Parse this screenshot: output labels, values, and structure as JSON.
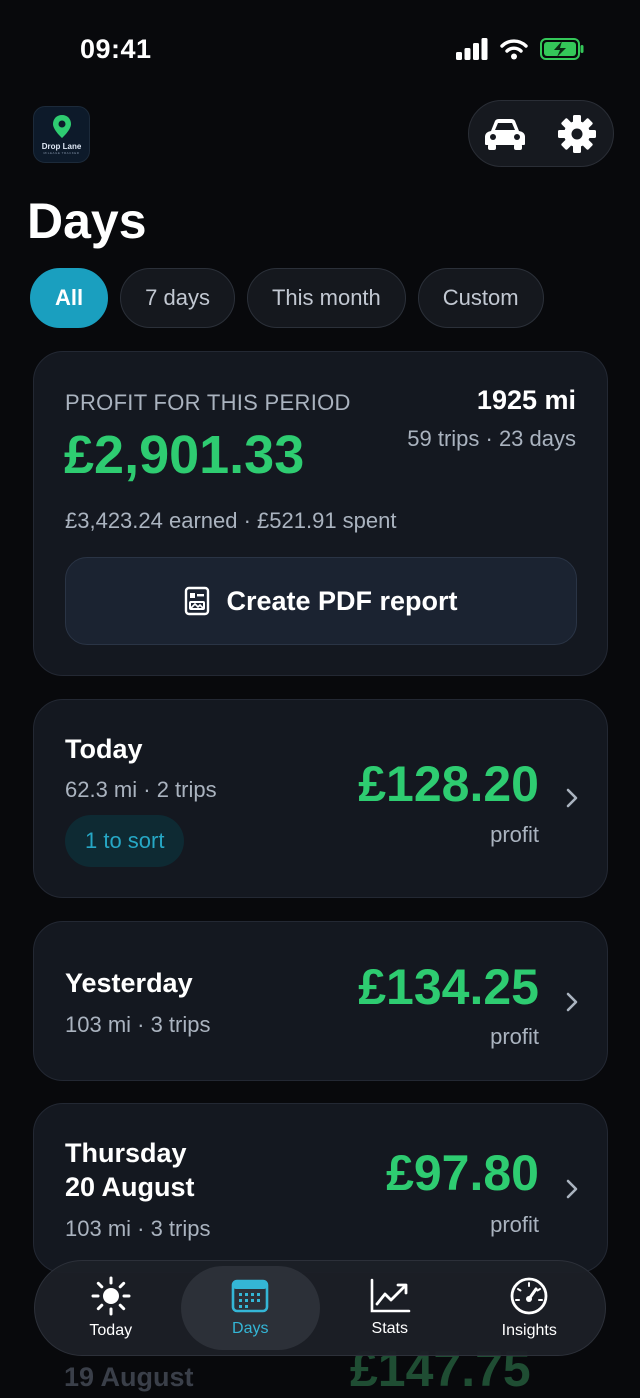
{
  "status_bar": {
    "time": "09:41"
  },
  "app": {
    "logo_name": "Drop Lane",
    "logo_tagline": "MILEAGE TRACKER"
  },
  "page": {
    "title": "Days"
  },
  "filters": [
    {
      "label": "All",
      "active": true
    },
    {
      "label": "7 days",
      "active": false
    },
    {
      "label": "This month",
      "active": false
    },
    {
      "label": "Custom",
      "active": false
    }
  ],
  "summary": {
    "label": "PROFIT FOR THIS PERIOD",
    "profit": "£2,901.33",
    "miles": "1925 mi",
    "trips_days": "59 trips · 23 days",
    "breakdown": "£3,423.24 earned · £521.91 spent",
    "pdf_button": "Create PDF report"
  },
  "days": [
    {
      "title": "Today",
      "subtitle": "62.3 mi · 2 trips",
      "profit": "£128.20",
      "profit_label": "profit",
      "badge": "1 to sort"
    },
    {
      "title": "Yesterday",
      "subtitle": "103 mi · 3 trips",
      "profit": "£134.25",
      "profit_label": "profit"
    },
    {
      "title_line1": "Thursday",
      "title_line2": "20 August",
      "subtitle": "103 mi · 3 trips",
      "profit": "£97.80",
      "profit_label": "profit"
    },
    {
      "title": "19 August",
      "profit": "£147.75"
    }
  ],
  "tabs": [
    {
      "label": "Today",
      "icon": "sun-icon",
      "active": false
    },
    {
      "label": "Days",
      "icon": "calendar-icon",
      "active": true
    },
    {
      "label": "Stats",
      "icon": "chart-icon",
      "active": false
    },
    {
      "label": "Insights",
      "icon": "gauge-icon",
      "active": false
    }
  ],
  "colors": {
    "accent": "#1a9fbf",
    "profit": "#2ecc71",
    "background": "#08090c",
    "card": "#141820",
    "battery": "#34c759"
  }
}
